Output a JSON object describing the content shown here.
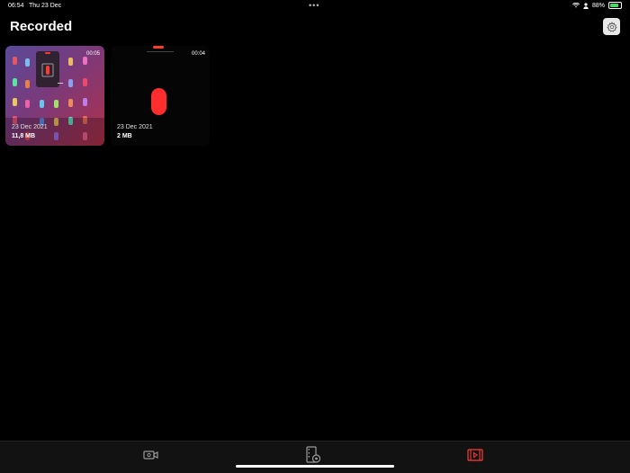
{
  "status": {
    "time": "06:54",
    "date": "Thu 23 Dec",
    "battery": "88%",
    "battery_level": 0.88,
    "multitask": "•••"
  },
  "page": {
    "title": "Recorded"
  },
  "recordings": [
    {
      "date": "23 Dec 2021",
      "size": "11,8 MB",
      "duration": "00:05"
    },
    {
      "date": "23 Dec 2021",
      "size": "2 MB",
      "duration": "00:04"
    }
  ],
  "tabs": [
    {
      "name": "record-tab",
      "icon": "video-camera-icon",
      "active": false
    },
    {
      "name": "edit-tab",
      "icon": "film-edit-icon",
      "active": false
    },
    {
      "name": "library-tab",
      "icon": "film-strip-icon",
      "active": true
    }
  ],
  "colors": {
    "accent": "#ff3b30",
    "background": "#000000",
    "tab_inactive": "#9a9a9a"
  }
}
